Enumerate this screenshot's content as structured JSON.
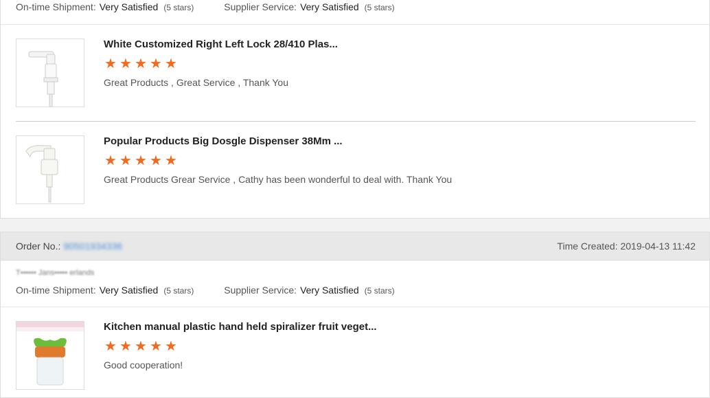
{
  "card1": {
    "ratings": {
      "shipment_label": "On-time Shipment:",
      "shipment_value": "Very Satisfied",
      "shipment_stars": "(5 stars)",
      "service_label": "Supplier Service:",
      "service_value": "Very Satisfied",
      "service_stars": "(5 stars)"
    },
    "products": [
      {
        "title": "White Customized Right Left Lock 28/410 Plas...",
        "stars": 5,
        "comment": "Great Products , Great Service , Thank You"
      },
      {
        "title": "Popular Products Big Dosgle Dispenser 38Mm ...",
        "stars": 5,
        "comment": "Great Products Grear Service , Cathy has been wonderful to deal with. Thank You"
      }
    ]
  },
  "card2": {
    "order_label": "Order No.:",
    "order_number": "90501934336",
    "time_created": "Time Created: 2019-04-13 11:42",
    "buyer": "T•••••• Jans••••• erlands",
    "ratings": {
      "shipment_label": "On-time Shipment:",
      "shipment_value": "Very Satisfied",
      "shipment_stars": "(5 stars)",
      "service_label": "Supplier Service:",
      "service_value": "Very Satisfied",
      "service_stars": "(5 stars)"
    },
    "products": [
      {
        "title": "Kitchen manual plastic hand held spiralizer fruit veget...",
        "stars": 5,
        "comment": "Good cooperation!"
      }
    ]
  },
  "colors": {
    "star": "#f46a1c",
    "link": "#4a90d9"
  }
}
